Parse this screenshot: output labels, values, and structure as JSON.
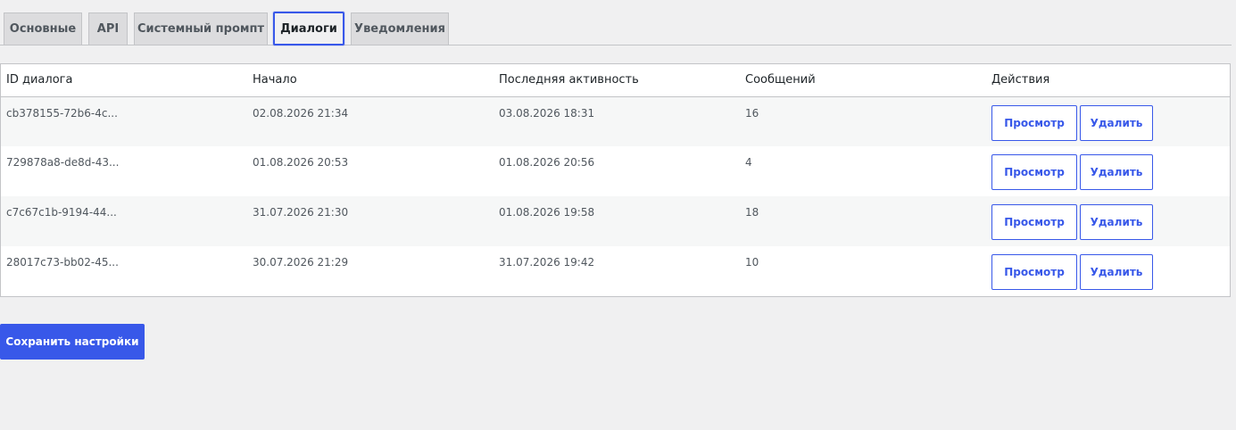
{
  "tabs": [
    {
      "label": "Основные"
    },
    {
      "label": "API"
    },
    {
      "label": "Системный промпт"
    },
    {
      "label": "Диалоги"
    },
    {
      "label": "Уведомления"
    }
  ],
  "active_tab": "Диалоги",
  "table": {
    "headers": {
      "id": "ID диалога",
      "start": "Начало",
      "last_activity": "Последняя активность",
      "messages": "Сообщений",
      "actions": "Действия"
    },
    "rows": [
      {
        "id": "cb378155-72b6-4c...",
        "start": "02.08.2026 21:34",
        "last_activity": "03.08.2026 18:31",
        "messages": "16",
        "view_label": "Просмотр",
        "delete_label": "Удалить"
      },
      {
        "id": "729878a8-de8d-43...",
        "start": "01.08.2026 20:53",
        "last_activity": "01.08.2026 20:56",
        "messages": "4",
        "view_label": "Просмотр",
        "delete_label": "Удалить"
      },
      {
        "id": "c7c67c1b-9194-44...",
        "start": "31.07.2026 21:30",
        "last_activity": "01.08.2026 19:58",
        "messages": "18",
        "view_label": "Просмотр",
        "delete_label": "Удалить"
      },
      {
        "id": "28017c73-bb02-45...",
        "start": "30.07.2026 21:29",
        "last_activity": "31.07.2026 19:42",
        "messages": "10",
        "view_label": "Просмотр",
        "delete_label": "Удалить"
      }
    ]
  },
  "save_button": {
    "label": "Сохранить настройки"
  },
  "colors": {
    "accent": "#3858e9",
    "background": "#f0f0f1",
    "tab_inactive": "#dcdcde"
  }
}
